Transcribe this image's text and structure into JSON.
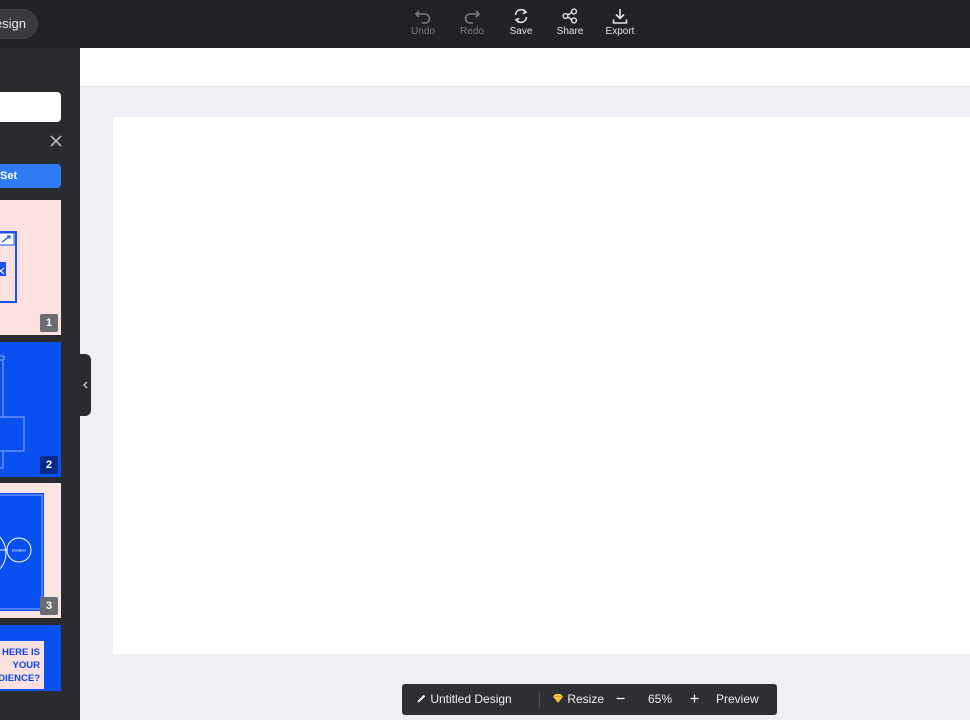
{
  "topbar": {
    "design_label": "esign",
    "tools": [
      {
        "label": "Undo",
        "icon": "undo-icon",
        "enabled": false
      },
      {
        "label": "Redo",
        "icon": "redo-icon",
        "enabled": false
      },
      {
        "label": "Save",
        "icon": "refresh-icon",
        "enabled": true
      },
      {
        "label": "Share",
        "icon": "share-icon",
        "enabled": true
      },
      {
        "label": "Export",
        "icon": "download-icon",
        "enabled": true
      }
    ]
  },
  "sidebar": {
    "set_button_label": "Set",
    "thumbnails": [
      {
        "number": "1"
      },
      {
        "number": "2"
      },
      {
        "number": "3"
      },
      {
        "text": "HERE IS YOUR DIENCE?"
      }
    ],
    "thumb3_small_label": "Donation"
  },
  "bottombar": {
    "design_name": "Untitled Design",
    "resize_label": "Resize",
    "zoom": "65%",
    "preview_label": "Preview"
  },
  "colors": {
    "topbar_bg": "#212226",
    "accent_blue": "#2f7bf6",
    "thumb_blue": "#0a4ff0",
    "thumb_pink": "#fce0e0"
  }
}
